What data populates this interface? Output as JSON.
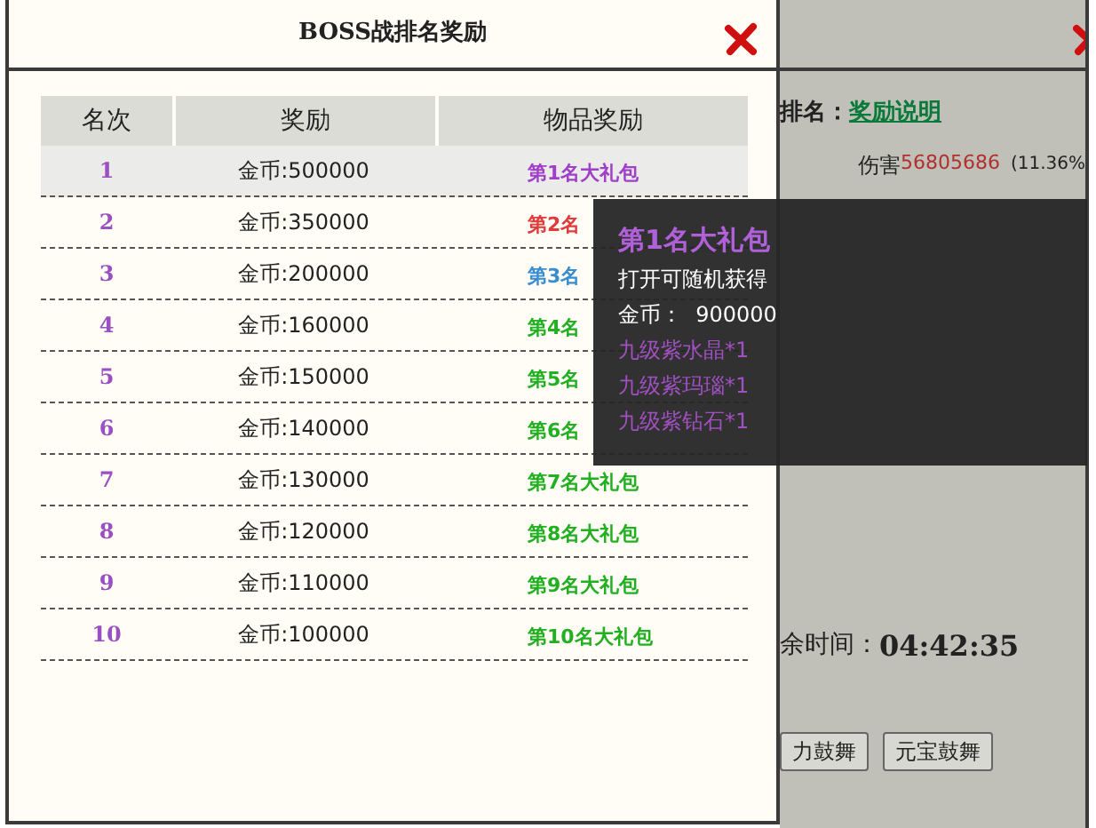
{
  "dialog": {
    "title": "BOSS战排名奖励",
    "table": {
      "columns": [
        "名次",
        "奖励",
        "物品奖励"
      ],
      "rows": [
        {
          "rank": "1",
          "reward": "金币:500000",
          "item": "第1名大礼包",
          "color": "#a040c8",
          "selected": true
        },
        {
          "rank": "2",
          "reward": "金币:350000",
          "item": "第2名",
          "color": "#e03a3a",
          "selected": false
        },
        {
          "rank": "3",
          "reward": "金币:200000",
          "item": "第3名",
          "color": "#3a8ed0",
          "selected": false
        },
        {
          "rank": "4",
          "reward": "金币:160000",
          "item": "第4名",
          "color": "#22b022",
          "selected": false
        },
        {
          "rank": "5",
          "reward": "金币:150000",
          "item": "第5名",
          "color": "#22b022",
          "selected": false
        },
        {
          "rank": "6",
          "reward": "金币:140000",
          "item": "第6名",
          "color": "#22b022",
          "selected": false
        },
        {
          "rank": "7",
          "reward": "金币:130000",
          "item": "第7名大礼包",
          "color": "#22b022",
          "selected": false
        },
        {
          "rank": "8",
          "reward": "金币:120000",
          "item": "第8名大礼包",
          "color": "#22b022",
          "selected": false
        },
        {
          "rank": "9",
          "reward": "金币:110000",
          "item": "第9名大礼包",
          "color": "#22b022",
          "selected": false
        },
        {
          "rank": "10",
          "reward": "金币:100000",
          "item": "第10名大礼包",
          "color": "#22b022",
          "selected": false
        }
      ]
    }
  },
  "tooltip": {
    "title": "第1名大礼包",
    "lines": [
      {
        "kind": "plain",
        "text": "打开可随机获得"
      },
      {
        "kind": "plain",
        "text": "金币：  900000"
      },
      {
        "kind": "item",
        "text": "九级紫水晶*1"
      },
      {
        "kind": "item",
        "text": "九级紫玛瑙*1"
      },
      {
        "kind": "item",
        "text": "九级紫钻石*1"
      }
    ]
  },
  "background_panel": {
    "ranking_label": "排名：",
    "reward_link": "奖励说明",
    "damage_label": "伤害",
    "damage_value": "56805686",
    "damage_share": "(11.36%",
    "timer_label": "余时间：",
    "timer": "04:42:35",
    "buttons": [
      "力鼓舞",
      "元宝鼓舞"
    ]
  }
}
